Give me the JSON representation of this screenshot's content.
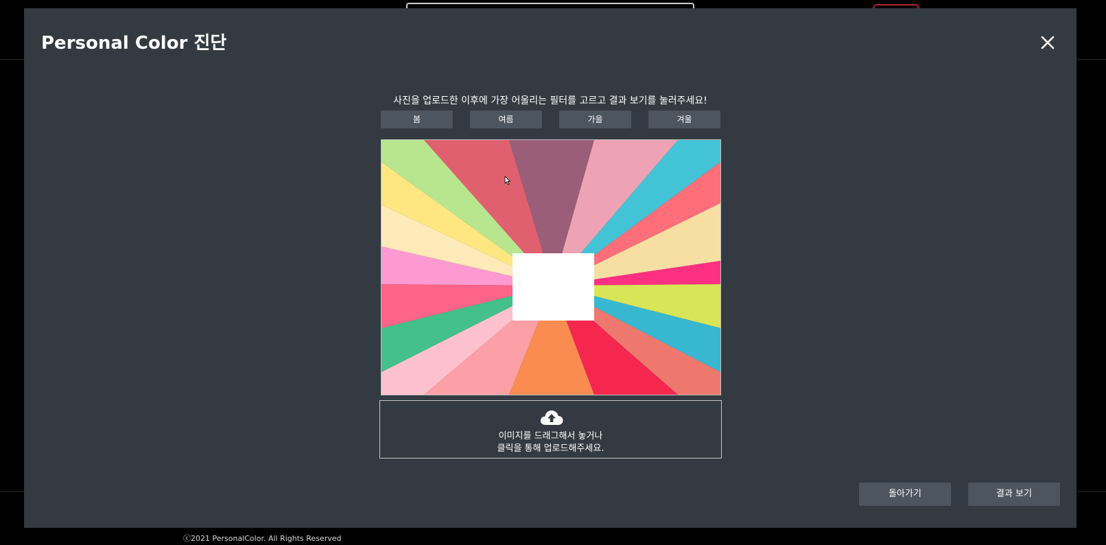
{
  "modal": {
    "title": "Personal Color 진단",
    "instruction": "사진을 업로드한 이후에 가장 어울리는 필터를 고르고 결과 보기를 눌러주세요!",
    "seasons": [
      {
        "label": "봄"
      },
      {
        "label": "여름"
      },
      {
        "label": "가을"
      },
      {
        "label": "겨울"
      }
    ],
    "preview": {
      "ray_colors": [
        "#b8e68e",
        "#e0606f",
        "#9a5e78",
        "#eea3b4",
        "#42c4d6",
        "#ff6f7a",
        "#f7dfa3",
        "#fd3081",
        "#d8e557",
        "#38b8d0",
        "#ef786e",
        "#f5274f",
        "#fa8b51",
        "#fc9fa6",
        "#fdc1cd",
        "#43c08b",
        "#fe6488",
        "#fe9ad2",
        "#feeab8",
        "#fee780"
      ],
      "center_color": "#ffffff"
    },
    "upload": {
      "line1": "이미지를 드래그해서 놓거나",
      "line2": "클릭을 통해 업로드해주세요."
    },
    "back_label": "돌아가기",
    "result_label": "결과 보기"
  },
  "footer": {
    "copyright": "ⓒ2021 PersonalColor. All Rights Reserved"
  },
  "colors": {
    "modal_bg": "#343a41",
    "button_bg": "#4d555f",
    "page_bg": "#000000"
  }
}
